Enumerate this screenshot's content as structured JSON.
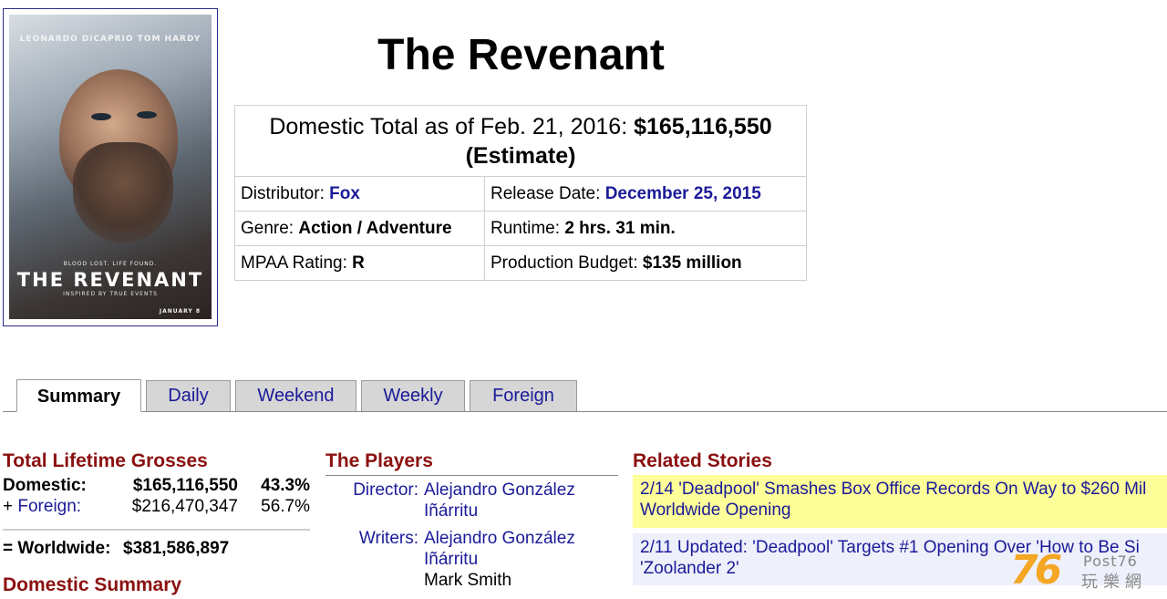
{
  "poster": {
    "alt": "The Revenant poster",
    "names": "LEONARDO DiCAPRIO   TOM HARDY",
    "tagline": "BLOOD LOST. LIFE FOUND.",
    "title": "THE REVENANT",
    "subtitle": "INSPIRED BY TRUE EVENTS",
    "date": "JANUARY 8"
  },
  "movie": {
    "title": "The Revenant"
  },
  "info": {
    "total_prefix": "Domestic Total as of Feb. 21, 2016: ",
    "total_value": "$165,116,550",
    "total_suffix": "(Estimate)",
    "distributor_label": "Distributor: ",
    "distributor_value": "Fox",
    "release_label": "Release Date: ",
    "release_value": "December 25, 2015",
    "genre_label": "Genre: ",
    "genre_value": "Action / Adventure",
    "runtime_label": "Runtime: ",
    "runtime_value": "2 hrs. 31 min.",
    "mpaa_label": "MPAA Rating: ",
    "mpaa_value": "R",
    "budget_label": "Production Budget: ",
    "budget_value": "$135 million"
  },
  "tabs": [
    {
      "label": "Summary",
      "active": true
    },
    {
      "label": "Daily",
      "active": false
    },
    {
      "label": "Weekend",
      "active": false
    },
    {
      "label": "Weekly",
      "active": false
    },
    {
      "label": "Foreign",
      "active": false
    }
  ],
  "grosses": {
    "heading": "Total Lifetime Grosses",
    "domestic_label": "Domestic:",
    "domestic_amount": "$165,116,550",
    "domestic_pct": "43.3%",
    "foreign_prefix": "+ ",
    "foreign_label": "Foreign:",
    "foreign_amount": "$216,470,347",
    "foreign_pct": "56.7%",
    "worldwide_label": "= Worldwide:",
    "worldwide_amount": "$381,586,897",
    "domestic_summary_heading": "Domestic Summary"
  },
  "players": {
    "heading": "The Players",
    "director_label": "Director:",
    "director_line1": "Alejandro González",
    "director_line2": "Iñárritu",
    "writers_label": "Writers:",
    "writers_line1": "Alejandro González",
    "writers_line2": "Iñárritu",
    "writers_line3": "Mark Smith"
  },
  "stories": {
    "heading": "Related Stories",
    "items": [
      {
        "line1": "2/14 'Deadpool' Smashes Box Office Records On Way to $260 Mil",
        "line2": "Worldwide Opening"
      },
      {
        "line1": "2/11 Updated: 'Deadpool' Targets #1 Opening Over 'How to Be Si",
        "line2": "'Zoolander 2'"
      }
    ]
  },
  "watermark": {
    "number": "76",
    "brand": "Post76",
    "chinese": "玩樂網"
  }
}
